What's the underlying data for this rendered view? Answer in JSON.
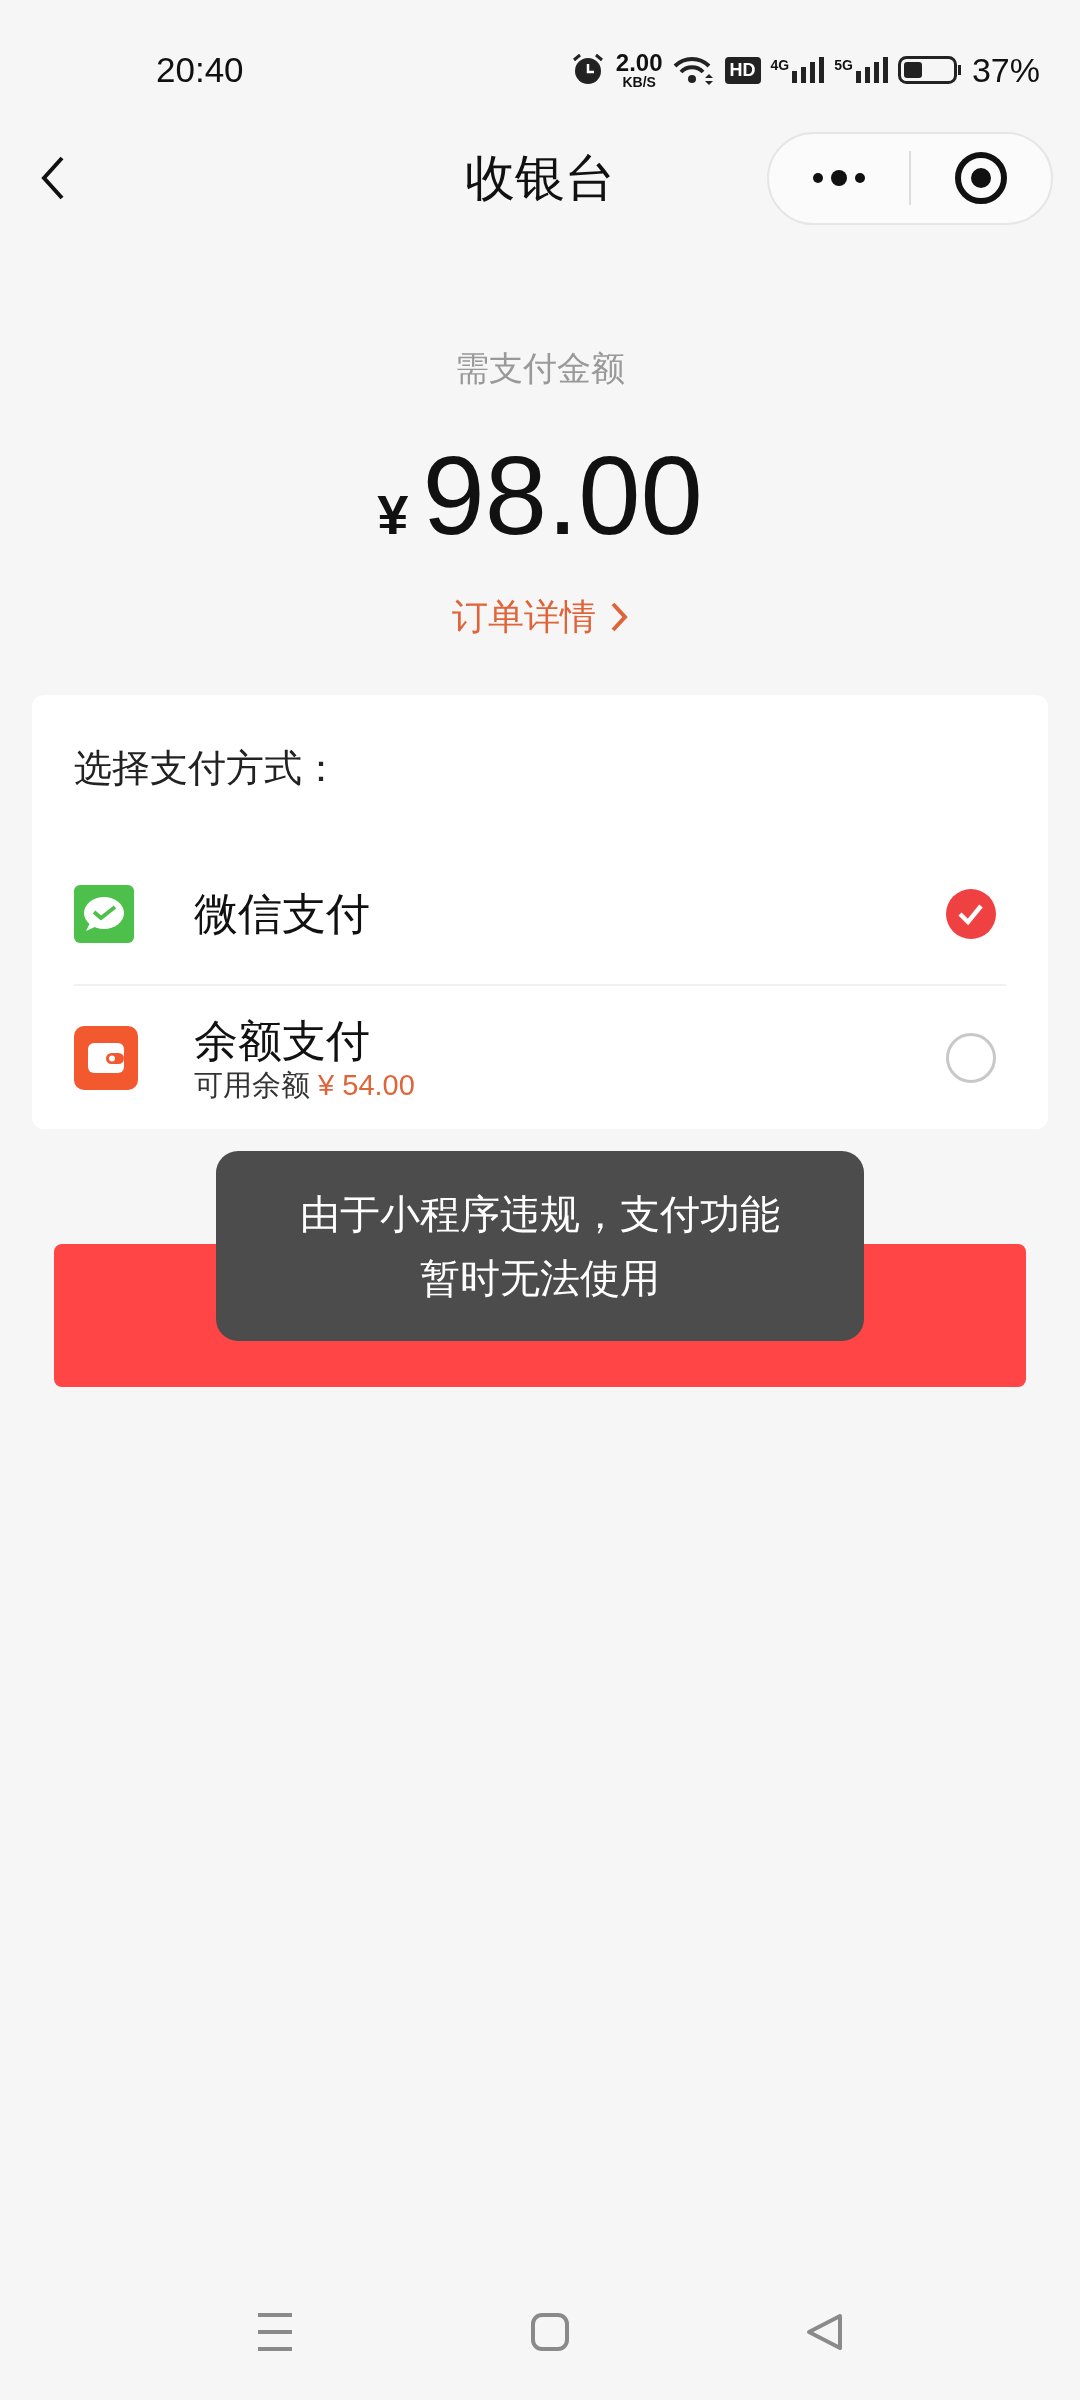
{
  "status_bar": {
    "time": "20:40",
    "speed": "2.00",
    "speed_unit": "KB/S",
    "hd": "HD",
    "network_1": "4G",
    "network_2": "5G",
    "battery": "37%"
  },
  "header": {
    "title": "收银台"
  },
  "amount": {
    "label": "需支付金额",
    "currency": "¥",
    "value": "98.00",
    "details_link": "订单详情"
  },
  "payment": {
    "title": "选择支付方式：",
    "methods": [
      {
        "kind": "wechat",
        "name": "微信支付",
        "selected": true
      },
      {
        "kind": "balance",
        "name": "余额支付",
        "note": "可用余额",
        "note_amount": "¥ 54.00",
        "selected": false
      }
    ]
  },
  "toast": {
    "message": "由于小程序违规，支付功能暂时无法使用"
  }
}
